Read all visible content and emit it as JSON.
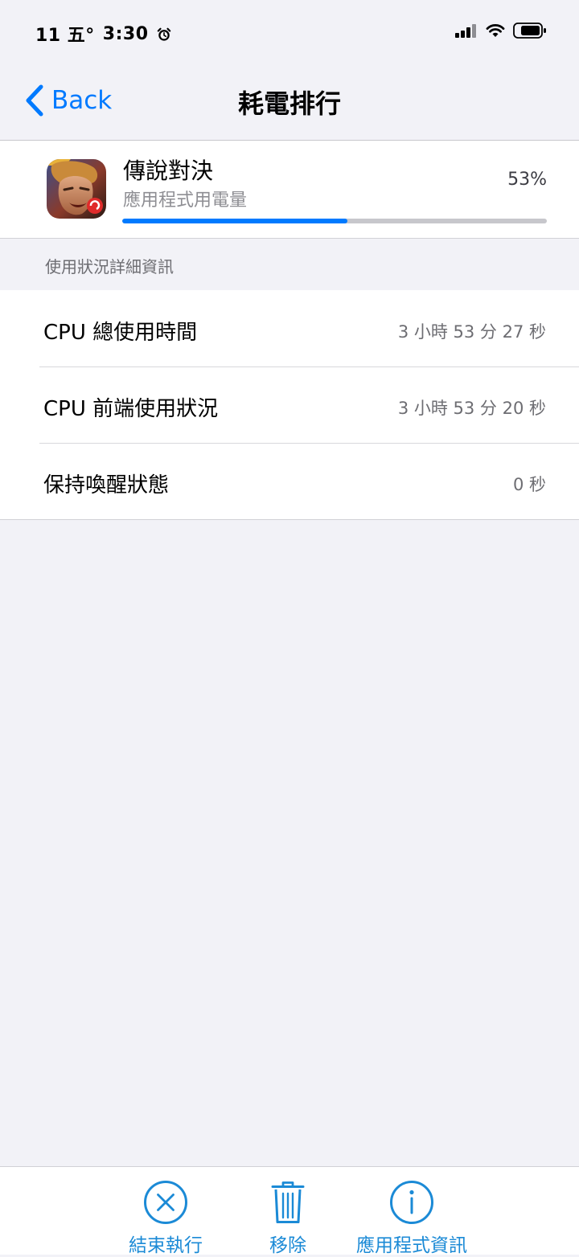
{
  "status_bar": {
    "time_prefix": "11 五°",
    "time": "3:30",
    "alarm_icon": "alarm-clock-icon",
    "signal_icon": "cellular-signal-icon",
    "wifi_icon": "wifi-icon",
    "battery_icon": "battery-icon"
  },
  "nav": {
    "back_label": "Back",
    "back_icon": "chevron-left-icon",
    "title": "耗電排行"
  },
  "app": {
    "name": "傳說對決",
    "subtitle": "應用程式用電量",
    "percent": "53%",
    "usage_fraction": 0.53,
    "icon": "game-app-icon"
  },
  "details": {
    "header": "使用狀況詳細資訊",
    "rows": [
      {
        "label": "CPU 總使用時間",
        "value": "3 小時 53 分 27 秒"
      },
      {
        "label": "CPU 前端使用狀況",
        "value": "3 小時 53 分 20 秒"
      },
      {
        "label": "保持喚醒狀態",
        "value": "0 秒"
      }
    ]
  },
  "toolbar": {
    "end_label": "結束執行",
    "end_icon": "close-circle-icon",
    "remove_label": "移除",
    "remove_icon": "trash-icon",
    "info_label": "應用程式資訊",
    "info_icon": "info-circle-icon"
  },
  "colors": {
    "accent": "#007aff",
    "toolbar_accent": "#1b8ad6",
    "background": "#f2f2f7",
    "progress_track": "#c7c7cc"
  }
}
